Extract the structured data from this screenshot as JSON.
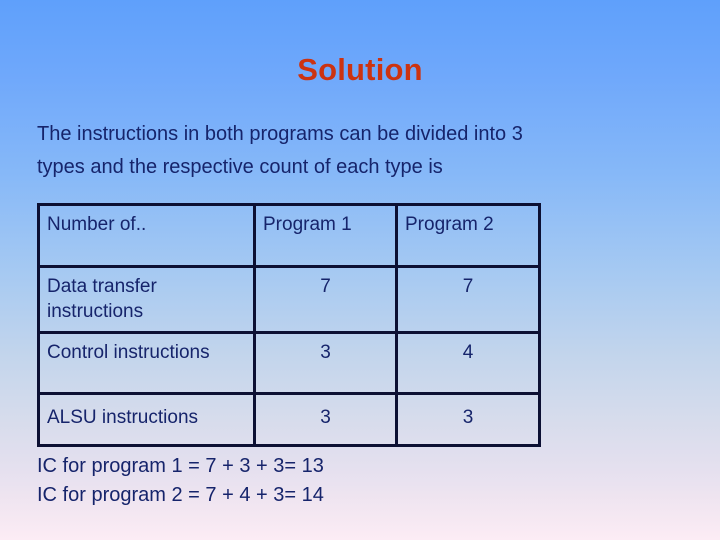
{
  "slide": {
    "title": "Solution",
    "title_color": "#cc3311",
    "text_color": "#16246b",
    "background_top_color": "#5fa0fb",
    "background_bottom_color": "#fcecf5"
  },
  "intro": {
    "line1": "The instructions in both programs can be divided into 3",
    "line2": "types and the respective count of each type is"
  },
  "table": {
    "headers": [
      "Number of..",
      "Program 1",
      "Program 2"
    ],
    "rows": [
      {
        "label": "Data transfer instructions",
        "label_line1": "Data transfer",
        "label_line2": "instructions",
        "program1": "7",
        "program2": "7"
      },
      {
        "label": "Control instructions",
        "label_line1": "Control instructions",
        "label_line2": "",
        "program1": "3",
        "program2": "4"
      },
      {
        "label": "ALSU instructions",
        "label_line1": "ALSU instructions",
        "label_line2": "",
        "program1": "3",
        "program2": "3"
      }
    ]
  },
  "footer": {
    "line1": "IC for program 1 = 7 + 3 + 3= 13",
    "line2": "IC for program 2 = 7 + 4 + 3= 14"
  },
  "chart_data": {
    "type": "table",
    "title": "Solution",
    "categories": [
      "Data transfer instructions",
      "Control instructions",
      "ALSU instructions"
    ],
    "series": [
      {
        "name": "Program 1",
        "values": [
          7,
          3,
          3
        ]
      },
      {
        "name": "Program 2",
        "values": [
          7,
          4,
          3
        ]
      }
    ],
    "totals": {
      "Program 1": 13,
      "Program 2": 14
    },
    "xlabel": "Number of..",
    "ylabel": "",
    "annotations": [
      "IC for program 1 = 7 + 3 + 3= 13",
      "IC for program 2 = 7 + 4 + 3= 14"
    ]
  }
}
